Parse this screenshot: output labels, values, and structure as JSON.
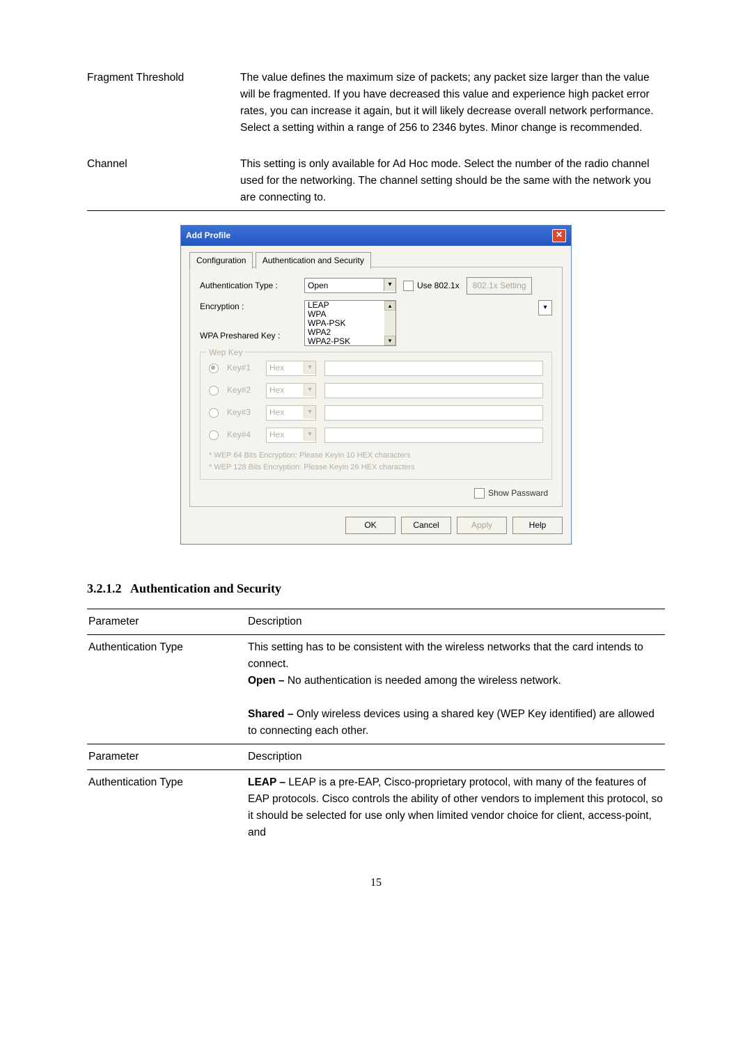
{
  "top_table": {
    "rows": [
      {
        "label": "Fragment Threshold",
        "desc": "The value defines the maximum size of packets; any packet size larger than the value will be fragmented. If you have decreased this value and experience high packet error rates, you can increase it again, but it will likely decrease overall network performance. Select a setting within a range of 256 to 2346 bytes. Minor change is recommended."
      },
      {
        "label": "Channel",
        "desc": "This setting is only available for Ad Hoc mode. Select the number of the radio channel used for the networking. The channel setting should be the same with the network you are connecting to."
      }
    ]
  },
  "dialog": {
    "title": "Add Profile",
    "tabs": {
      "config": "Configuration",
      "auth": "Authentication and Security"
    },
    "auth_type_label": "Authentication Type :",
    "auth_type_value": "Open",
    "auth_list": [
      "LEAP",
      "WPA",
      "WPA-PSK",
      "WPA2",
      "WPA2-PSK"
    ],
    "use8021x_label": "Use 802.1x",
    "btn_8021x": "802.1x Setting",
    "encryption_label": "Encryption :",
    "wpakey_label": "WPA Preshared Key :",
    "wep_legend": "Wep Key",
    "keys": [
      {
        "name": "Key#1",
        "fmt": "Hex",
        "sel": true
      },
      {
        "name": "Key#2",
        "fmt": "Hex",
        "sel": false
      },
      {
        "name": "Key#3",
        "fmt": "Hex",
        "sel": false
      },
      {
        "name": "Key#4",
        "fmt": "Hex",
        "sel": false
      }
    ],
    "hint1": "* WEP 64 Bits Encryption:    Please Keyin 10 HEX characters",
    "hint2": "* WEP 128 Bits Encryption:    Please Keyin 26 HEX characters",
    "show_pw": "Show Passward",
    "btn_ok": "OK",
    "btn_cancel": "Cancel",
    "btn_apply": "Apply",
    "btn_help": "Help"
  },
  "section": {
    "number": "3.2.1.2",
    "title": "Authentication and Security"
  },
  "param_table": {
    "hdr_param": "Parameter",
    "hdr_desc": "Description",
    "r1_param": "Authentication Type",
    "r1_line1": "This setting has to be consistent with the wireless networks that the card intends to connect.",
    "r1_open_b": "Open –",
    "r1_open_t": " No authentication is needed among the wireless network.",
    "r1_shared_b": "Shared –",
    "r1_shared_t": " Only wireless devices using a shared key (WEP Key identified) are allowed to connecting each other.",
    "r2_param": "Authentication Type",
    "r2_leap_b": "LEAP –",
    "r2_leap_t": " LEAP is a pre-EAP, Cisco-proprietary protocol, with many of the features of EAP protocols. Cisco controls the ability of other vendors to implement this protocol, so it should be selected for use only when limited vendor choice for client, access-point, and"
  },
  "page_number": "15"
}
